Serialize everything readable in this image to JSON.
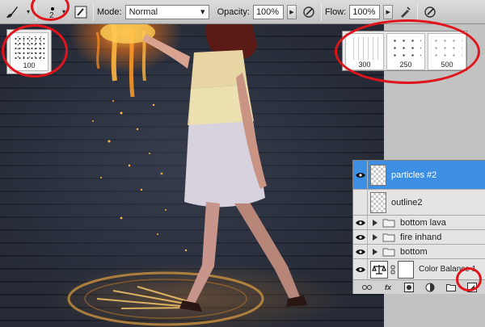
{
  "options_bar": {
    "brush_size": "2",
    "mode_label": "Mode:",
    "mode_value": "Normal",
    "opacity_label": "Opacity:",
    "opacity_value": "100%",
    "flow_label": "Flow:",
    "flow_value": "100%"
  },
  "brush_preview": {
    "label": "100"
  },
  "brush_presets": [
    {
      "label": "300"
    },
    {
      "label": "250"
    },
    {
      "label": "500"
    }
  ],
  "layers": {
    "rows": [
      {
        "name": "particles #2",
        "selected": true
      },
      {
        "name": "outline2"
      },
      {
        "name": "bottom lava"
      },
      {
        "name": "fire inhand"
      },
      {
        "name": "bottom"
      },
      {
        "name": "Color Balance 1"
      }
    ]
  },
  "colors": {
    "highlight_ring": "#e0141a",
    "selected_layer": "#3d8fe3"
  }
}
